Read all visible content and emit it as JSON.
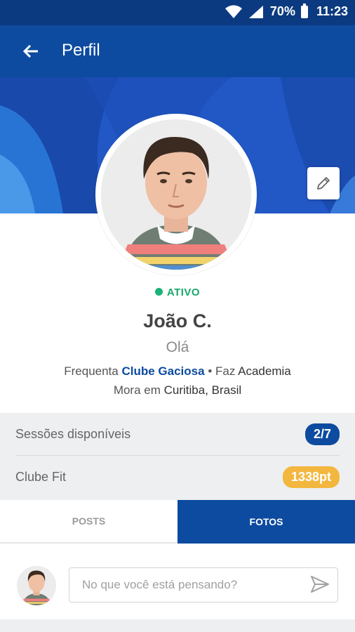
{
  "status_bar": {
    "battery_percent": "70%",
    "time": "11:23"
  },
  "app_bar": {
    "title": "Perfil"
  },
  "profile": {
    "status": "ATIVO",
    "name": "João C.",
    "bio": "Olá",
    "frequent_prefix": "Frequenta",
    "club": "Clube Gaciosa",
    "bullet": "•",
    "activity_prefix": "Faz",
    "activity": "Academia",
    "lives_prefix": "Mora em",
    "location": "Curitiba, Brasil"
  },
  "stats": {
    "sessions_label": "Sessões disponíveis",
    "sessions_value": "2/7",
    "fit_label": "Clube Fit",
    "fit_value": "1338pt"
  },
  "tabs": [
    {
      "label": "POSTS",
      "active": false
    },
    {
      "label": "FOTOS",
      "active": true
    }
  ],
  "composer": {
    "placeholder": "No que você está pensando?"
  },
  "colors": {
    "primary": "#0d4ba0",
    "status_green": "#1bb27a",
    "points_orange": "#f3b73f"
  },
  "icons": [
    "wifi-icon",
    "signal-icon",
    "battery-icon",
    "back-arrow-icon",
    "pencil-icon",
    "send-icon"
  ]
}
